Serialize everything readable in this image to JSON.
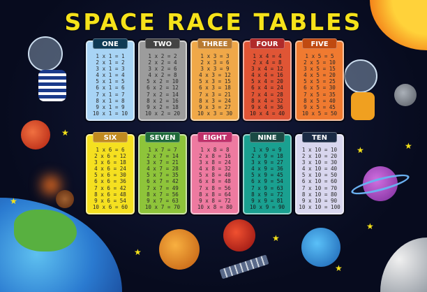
{
  "title": "SPACE RACE TABLES",
  "tables": [
    {
      "label": "ONE",
      "color": "#a8d4f5",
      "label_color": "#0e3a55",
      "rows": [
        "1 x 1 = 1",
        "2 x 1 = 2",
        "3 x 1 = 3",
        "4 x 1 = 4",
        "5 x 1 = 5",
        "6 x 1 = 6",
        "7 x 1 = 7",
        "8 x 1 = 8",
        "9 x 1 = 9",
        "10 x 1 = 10"
      ]
    },
    {
      "label": "TWO",
      "color": "#9c9c9c",
      "label_color": "#434343",
      "rows": [
        "1 x 2 = 2",
        "2 x 2 = 4",
        "3 x 2 = 6",
        "4 x 2 = 8",
        "5 x 2 = 10",
        "6 x 2 = 12",
        "7 x 2 = 14",
        "8 x 2 = 16",
        "9 x 2 = 18",
        "10 x 2 = 20"
      ]
    },
    {
      "label": "THREE",
      "color": "#f0a848",
      "label_color": "#b87a30",
      "rows": [
        "1 x 3 = 3",
        "2 x 3 = 6",
        "3 x 3 = 9",
        "4 x 3 = 12",
        "5 x 3 = 15",
        "6 x 3 = 18",
        "7 x 3 = 21",
        "8 x 3 = 24",
        "9 x 3 = 27",
        "10 x 3 = 30"
      ]
    },
    {
      "label": "FOUR",
      "color": "#e05535",
      "label_color": "#b02a2a",
      "rows": [
        "1 x 4 = 4",
        "2 x 4 = 8",
        "3 x 4 = 12",
        "4 x 4 = 16",
        "5 x 4 = 20",
        "6 x 4 = 24",
        "7 x 4 = 28",
        "8 x 4 = 32",
        "9 x 4 = 36",
        "10 x 4 = 40"
      ]
    },
    {
      "label": "FIVE",
      "color": "#f07a30",
      "label_color": "#c04a10",
      "rows": [
        "1 x 5 = 5",
        "2 x 5 = 10",
        "3 x 5 = 15",
        "4 x 5 = 20",
        "5 x 5 = 25",
        "6 x 5 = 30",
        "7 x 5 = 35",
        "8 x 5 = 40",
        "9 x 5 = 45",
        "10 x 5 = 50"
      ]
    },
    {
      "label": "SIX",
      "color": "#f5e020",
      "label_color": "#c08a20",
      "rows": [
        "1 x 6 = 6",
        "2 x 6 = 12",
        "3 x 6 = 18",
        "4 x 6 = 24",
        "5 x 6 = 30",
        "6 x 6 = 36",
        "7 x 6 = 42",
        "8 x 6 = 48",
        "9 x 6 = 54",
        "10 x 6 = 60"
      ]
    },
    {
      "label": "SEVEN",
      "color": "#8ec43a",
      "label_color": "#1f6a3a",
      "rows": [
        "1 x 7 = 7",
        "2 x 7 = 14",
        "3 x 7 = 21",
        "4 x 7 = 28",
        "5 x 7 = 35",
        "6 x 7 = 42",
        "7 x 7 = 49",
        "8 x 7 = 56",
        "9 x 7 = 63",
        "10 x 7 = 70"
      ]
    },
    {
      "label": "EIGHT",
      "color": "#ee7aa0",
      "label_color": "#c0306a",
      "rows": [
        "1 x 8 = 8",
        "2 x 8 = 16",
        "3 x 8 = 24",
        "4 x 8 = 32",
        "5 x 8 = 40",
        "6 x 8 = 48",
        "7 x 8 = 56",
        "8 x 8 = 64",
        "9 x 8 = 72",
        "10 x 8 = 80"
      ]
    },
    {
      "label": "NINE",
      "color": "#1aa090",
      "label_color": "#1a4a44",
      "rows": [
        "1 x 9 = 9",
        "2 x 9 = 18",
        "3 x 9 = 27",
        "4 x 9 = 36",
        "5 x 9 = 45",
        "6 x 9 = 54",
        "7 x 9 = 63",
        "8 x 9 = 72",
        "9 x 9 = 81",
        "10 x 9 = 90"
      ]
    },
    {
      "label": "TEN",
      "color": "#d8d6ee",
      "label_color": "#1a2a44",
      "rows": [
        "1 x 10 = 10",
        "2 x 10 = 20",
        "3 x 10 = 30",
        "4 x 10 = 40",
        "5 x 10 = 50",
        "6 x 10 = 60",
        "7 x 10 = 70",
        "8 x 10 = 80",
        "9 x 10 = 90",
        "10 x 10 = 100"
      ]
    }
  ]
}
